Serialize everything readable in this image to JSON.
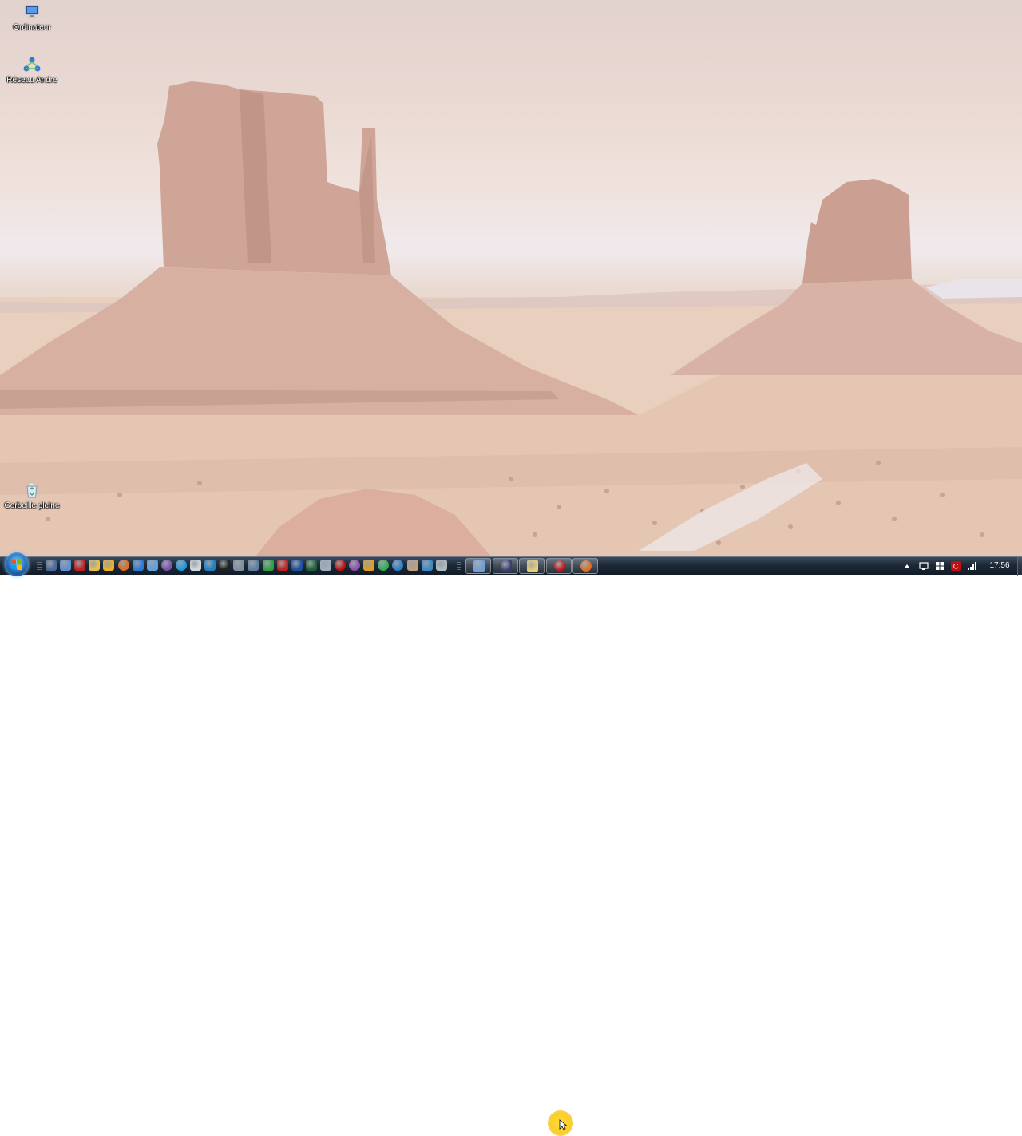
{
  "desktop": {
    "icons": [
      {
        "label": "Ordinateur",
        "icon": "computer-icon"
      },
      {
        "label": "Réseau Andre",
        "icon": "network-icon"
      },
      {
        "label": "Corbeille pleine",
        "icon": "recycle-bin-icon"
      }
    ]
  },
  "taskbar": {
    "start_icon": "windows-logo-icon",
    "quick_launch": [
      {
        "icon": "show-desktop-icon",
        "color": "#4a6a9a"
      },
      {
        "icon": "network-tool-icon",
        "color": "#5f8fd0"
      },
      {
        "icon": "pdf-icon",
        "color": "#c02020"
      },
      {
        "icon": "folder-icon",
        "color": "#e8c050"
      },
      {
        "icon": "yellow-app-icon",
        "color": "#f0b020"
      },
      {
        "icon": "firefox-icon",
        "color": "#e56a1a"
      },
      {
        "icon": "internet-explorer-icon",
        "color": "#2a7ad8"
      },
      {
        "icon": "windows-update-icon",
        "color": "#5fa0e0"
      },
      {
        "icon": "viber-icon",
        "color": "#7a4fb0"
      },
      {
        "icon": "skype-icon",
        "color": "#1a9ae0"
      },
      {
        "icon": "swirl-app-icon",
        "color": "#d0d8e0"
      },
      {
        "icon": "blue-box-icon",
        "color": "#2080c0"
      },
      {
        "icon": "black-app-icon",
        "color": "#202020"
      },
      {
        "icon": "pen-tool-icon",
        "color": "#8090a0"
      },
      {
        "icon": "network-app-icon",
        "color": "#6080a0"
      },
      {
        "icon": "gallery-icon",
        "color": "#30a040"
      },
      {
        "icon": "filezilla-icon",
        "color": "#c02020"
      },
      {
        "icon": "word-icon",
        "color": "#2050a0"
      },
      {
        "icon": "dreamweaver-icon",
        "color": "#20603a"
      },
      {
        "icon": "notepad-icon",
        "color": "#a0b0c0"
      },
      {
        "icon": "record-icon",
        "color": "#c01010"
      },
      {
        "icon": "disc-icon",
        "color": "#9050b0"
      },
      {
        "icon": "r-app-icon",
        "color": "#e0a020"
      },
      {
        "icon": "green-circle-icon",
        "color": "#30b050"
      },
      {
        "icon": "blue-circle-icon",
        "color": "#2a80d0"
      },
      {
        "icon": "settings-icon",
        "color": "#c0a080"
      },
      {
        "icon": "blue-app-icon",
        "color": "#3a8ac8"
      },
      {
        "icon": "grey-box-icon",
        "color": "#b0b8c0"
      }
    ],
    "task_buttons": [
      {
        "icon": "document-window-icon",
        "color": "#6fa0d8"
      },
      {
        "icon": "application-window-icon",
        "color": "#3a3a6a"
      },
      {
        "icon": "explorer-window-icon",
        "color": "#e8d070"
      },
      {
        "icon": "recorder-window-icon",
        "color": "#c01010"
      },
      {
        "icon": "firefox-window-icon",
        "color": "#e56a1a"
      }
    ],
    "tray": [
      {
        "icon": "show-hidden-icons-icon"
      },
      {
        "icon": "monitor-icon"
      },
      {
        "icon": "windows-flag-icon"
      },
      {
        "icon": "signal-bars-icon"
      },
      {
        "icon": "antivirus-icon",
        "color": "#c01010"
      },
      {
        "icon": "volume-icon"
      }
    ],
    "clock": "17:56"
  }
}
